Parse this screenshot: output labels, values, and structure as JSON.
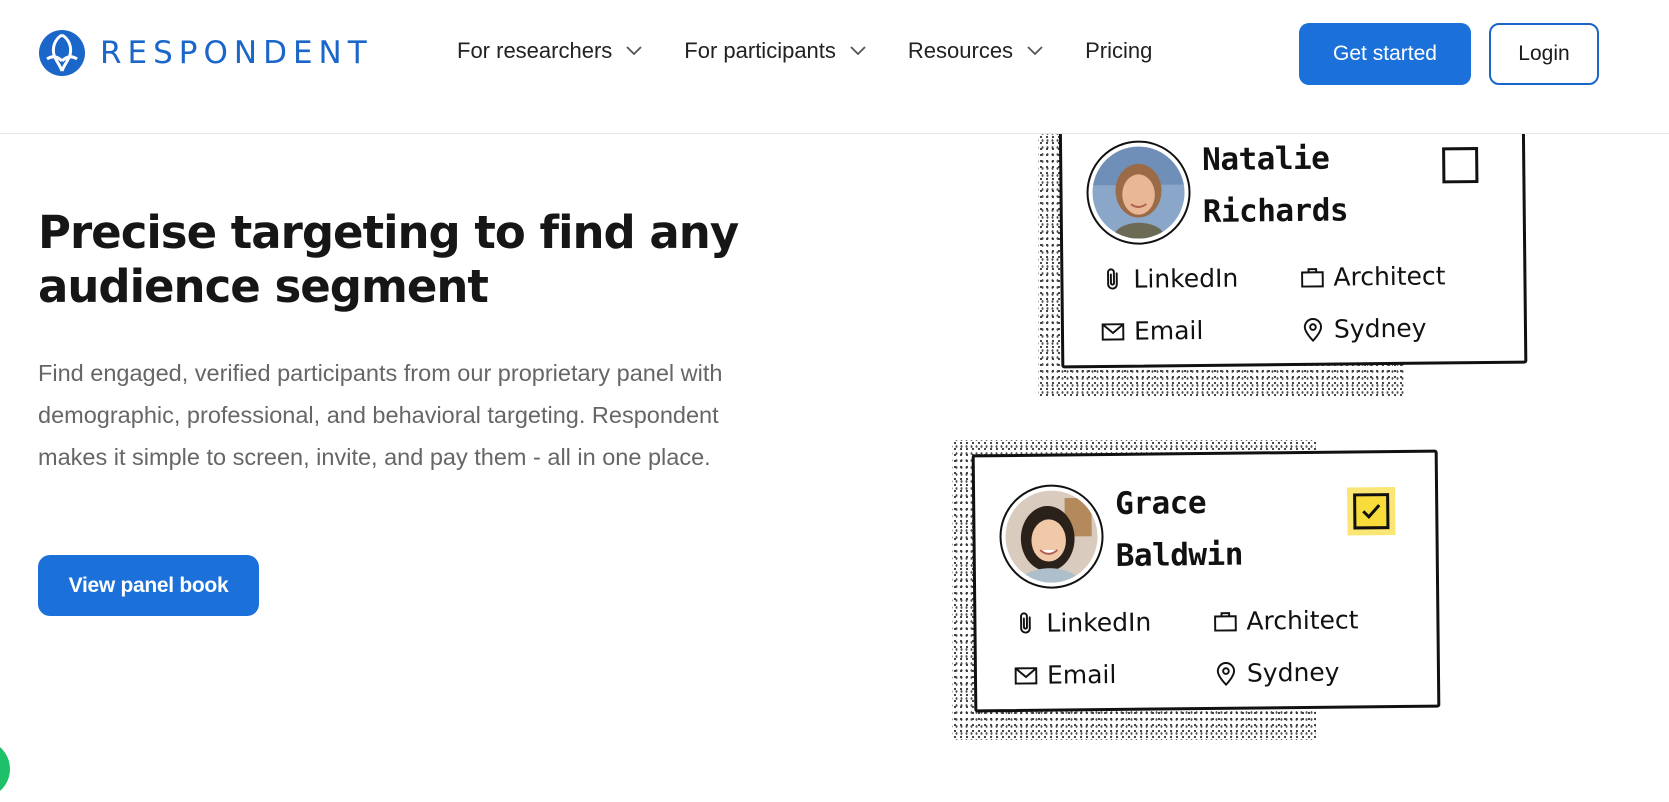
{
  "brand": {
    "name": "RESPONDENT",
    "color": "#1b66c9"
  },
  "nav": {
    "items": [
      {
        "label": "For researchers",
        "dropdown": true
      },
      {
        "label": "For participants",
        "dropdown": true
      },
      {
        "label": "Resources",
        "dropdown": true
      },
      {
        "label": "Pricing",
        "dropdown": false
      }
    ],
    "get_started": "Get started",
    "login": "Login"
  },
  "hero": {
    "headline": "Precise targeting to find any audience segment",
    "description": "Find engaged, verified participants from our proprietary panel with demographic, professional, and behavioral targeting. Respondent makes it simple to screen, invite, and pay them - all in one place.",
    "cta": "View panel book"
  },
  "cards": [
    {
      "first_name": "Natalie",
      "last_name": "Richards",
      "checked": false,
      "fields": {
        "linkedin": "LinkedIn",
        "job": "Architect",
        "email": "Email",
        "location": "Sydney"
      }
    },
    {
      "first_name": "Grace",
      "last_name": "Baldwin",
      "checked": true,
      "fields": {
        "linkedin": "LinkedIn",
        "job": "Architect",
        "email": "Email",
        "location": "Sydney"
      }
    }
  ],
  "colors": {
    "primary": "#1b71d9",
    "check_highlight": "#f7dc3a",
    "chat_bubble": "#1fc06a"
  }
}
